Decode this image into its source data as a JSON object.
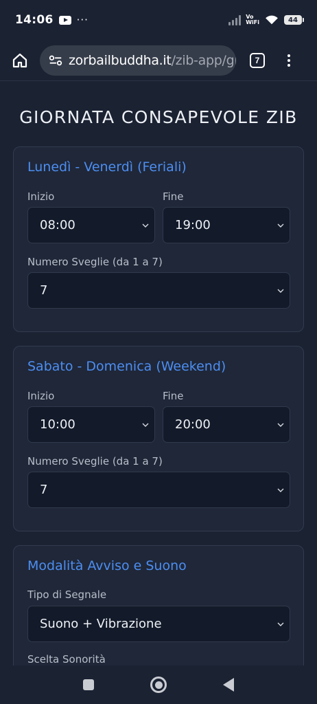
{
  "status_bar": {
    "time": "14:06",
    "notification_dots": "···",
    "vowifi_top": "Vo",
    "vowifi_bottom": "WiFi",
    "battery": "44"
  },
  "browser": {
    "url_domain": "zorbailbuddha.it",
    "url_path": "/zib-app/gio",
    "tab_count": "7"
  },
  "page": {
    "title": "GIORNATA CONSAPEVOLE ZIB"
  },
  "weekdays": {
    "title": "Lunedì - Venerdì (Feriali)",
    "start_label": "Inizio",
    "start_value": "08:00",
    "end_label": "Fine",
    "end_value": "19:00",
    "alarms_label": "Numero Sveglie (da 1 a 7)",
    "alarms_value": "7"
  },
  "weekend": {
    "title": "Sabato - Domenica (Weekend)",
    "start_label": "Inizio",
    "start_value": "10:00",
    "end_label": "Fine",
    "end_value": "20:00",
    "alarms_label": "Numero Sveglie (da 1 a 7)",
    "alarms_value": "7"
  },
  "alert": {
    "title": "Modalità Avviso e Suono",
    "signal_label": "Tipo di Segnale",
    "signal_value": "Suono + Vibrazione",
    "sound_label": "Scelta Sonorità"
  },
  "colors": {
    "background": "#1b2232",
    "card": "#1f2738",
    "accent": "#4d8ef2",
    "select_bg": "#131a29"
  }
}
